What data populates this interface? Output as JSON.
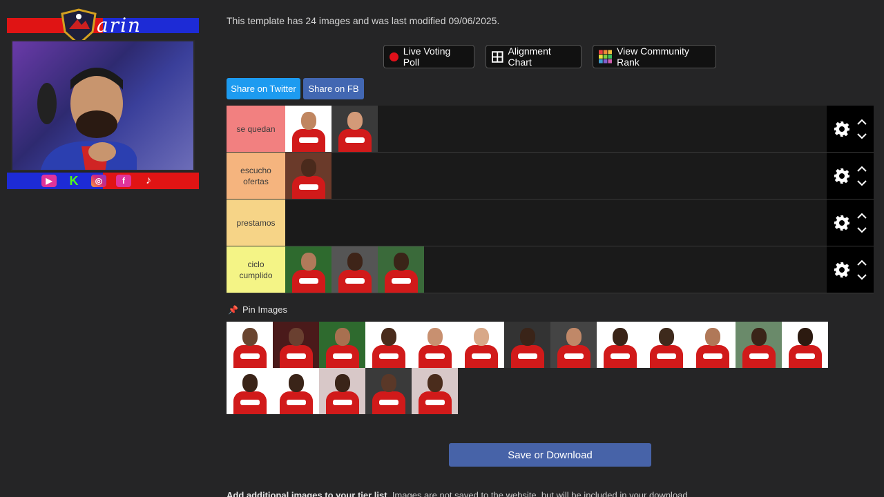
{
  "overlay": {
    "streamer_name": "arin",
    "social_icons": [
      "youtube-icon",
      "kick-icon",
      "instagram-icon",
      "facebook-icon",
      "tiktok-icon"
    ]
  },
  "info_text": "This template has 24 images and was last modified 09/06/2025.",
  "toolbar": {
    "live_voting": "Live Voting Poll",
    "alignment_chart": "Alignment Chart",
    "community_rank": "View Community Rank"
  },
  "share": {
    "twitter": "Share on Twitter",
    "fb": "Share on FB"
  },
  "tiers": [
    {
      "label": "se quedan",
      "color": "#f28080",
      "items": [
        {
          "bg": "#ffffff",
          "skin": "#c08660"
        },
        {
          "bg": "#3a3a3a",
          "skin": "#d39a78"
        }
      ]
    },
    {
      "label": "escucho ofertas",
      "color": "#f5b47e",
      "items": [
        {
          "bg": "#6a3a2a",
          "skin": "#4a2a1c"
        }
      ]
    },
    {
      "label": "prestamos",
      "color": "#f6d487",
      "items": []
    },
    {
      "label": "ciclo cumplido",
      "color": "#f4f486",
      "items": [
        {
          "bg": "#2e6a2e",
          "skin": "#b07a5a"
        },
        {
          "bg": "#555555",
          "skin": "#3e2418"
        },
        {
          "bg": "#3a6a3a",
          "skin": "#3a2418"
        }
      ]
    }
  ],
  "pin_label": "Pin Images",
  "pool": [
    {
      "bg": "#ffffff",
      "skin": "#6a4530"
    },
    {
      "bg": "#4a1a1a",
      "skin": "#6a4030"
    },
    {
      "bg": "#2e6a2e",
      "skin": "#a87050"
    },
    {
      "bg": "#ffffff",
      "skin": "#4a2c1c"
    },
    {
      "bg": "#ffffff",
      "skin": "#c89070"
    },
    {
      "bg": "#ffffff",
      "skin": "#d8a888"
    },
    {
      "bg": "#333333",
      "skin": "#3a2418"
    },
    {
      "bg": "#444444",
      "skin": "#c08868"
    },
    {
      "bg": "#ffffff",
      "skin": "#3a2418"
    },
    {
      "bg": "#ffffff",
      "skin": "#3e2a1c"
    },
    {
      "bg": "#ffffff",
      "skin": "#b07858"
    },
    {
      "bg": "#6a8a6a",
      "skin": "#3a2418"
    },
    {
      "bg": "#ffffff",
      "skin": "#2c1a10"
    },
    {
      "bg": "#ffffff",
      "skin": "#3a2418"
    },
    {
      "bg": "#ffffff",
      "skin": "#3a2418"
    },
    {
      "bg": "#d8c8c8",
      "skin": "#3a2418"
    },
    {
      "bg": "#3a3a3a",
      "skin": "#5a3828"
    },
    {
      "bg": "#d8c8c8",
      "skin": "#4a2c1c"
    }
  ],
  "save_label": "Save or Download",
  "footnote": {
    "bold": "Add additional images to your tier list.",
    "rest": " Images are not saved to the website, but will be included in your download."
  }
}
